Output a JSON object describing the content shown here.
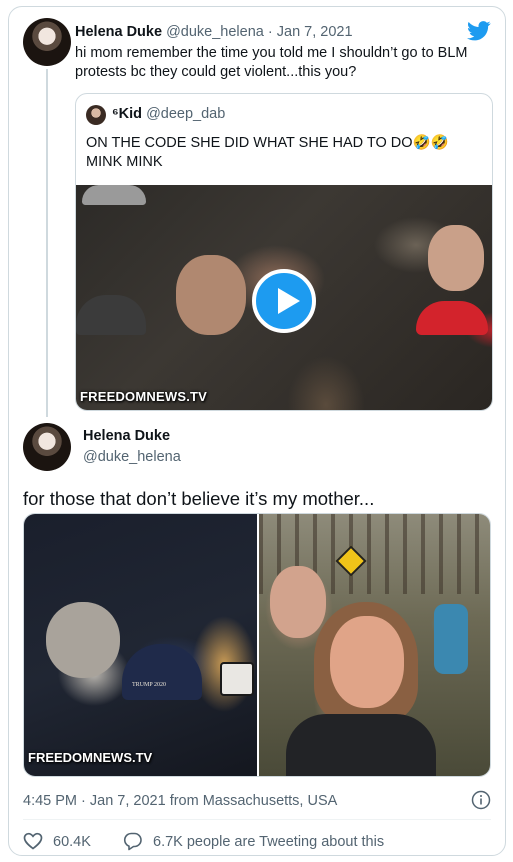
{
  "tweet1": {
    "name": "Helena Duke",
    "handle": "@duke_helena",
    "separator": " · ",
    "date": "Jan 7, 2021",
    "text": "hi mom remember the time you told me I shouldn’t go to BLM protests bc they could get violent...this you?"
  },
  "quote": {
    "name": "⁶Kid",
    "handle": "@deep_dab",
    "text_line1": "ON THE CODE SHE DID WHAT SHE HAD TO DO🤣🤣",
    "text_line2": "MINK MINK",
    "watermark": "FREEDOMNEWS.TV"
  },
  "tweet2": {
    "name": "Helena Duke",
    "handle": "@duke_helena",
    "text": "for those that don’t believe it’s my mother...",
    "image_left_watermark": "FREEDOMNEWS.TV",
    "cap_text": "TRUMP 2020",
    "timestamp": "4:45 PM · Jan 7, 2021 from Massachusetts, USA",
    "likes": "60.4K",
    "replies_text": "6.7K people are Tweeting about this"
  },
  "colors": {
    "twitter_blue": "#1d9bf0",
    "secondary_text": "#536471",
    "border": "#cfd9de"
  },
  "icons": [
    "twitter-bird-icon",
    "play-icon",
    "info-icon",
    "heart-icon",
    "speech-bubble-icon"
  ]
}
